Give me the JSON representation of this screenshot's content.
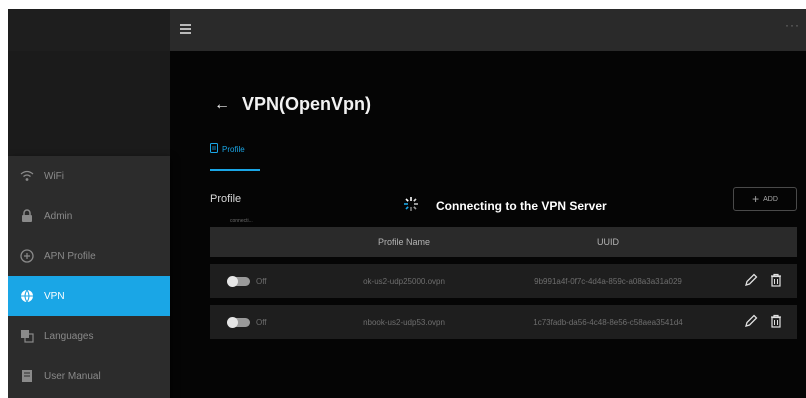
{
  "topbar": {
    "menu_icon": "hamburger-icon",
    "more": "···"
  },
  "sidebar": {
    "items": [
      {
        "label": "WiFi",
        "icon": "wifi-icon"
      },
      {
        "label": "Admin",
        "icon": "lock-icon"
      },
      {
        "label": "APN Profile",
        "icon": "apn-profile-icon"
      },
      {
        "label": "VPN",
        "icon": "vpn-icon",
        "active": true
      },
      {
        "label": "Languages",
        "icon": "language-icon"
      },
      {
        "label": "User Manual",
        "icon": "manual-icon"
      }
    ]
  },
  "page": {
    "back_icon": "←",
    "title": "VPN(OpenVpn)",
    "tab_label": "Profile",
    "section_title": "Profile",
    "connecting_small": "connecti...",
    "add_label": "ADD",
    "add_plus": "+",
    "loading_text": "Connecting to the VPN Server"
  },
  "table": {
    "headers": [
      "Profile Name",
      "UUID"
    ],
    "rows": [
      {
        "state": "Off",
        "profile_name": "ok-us2-udp25000.ovpn",
        "uuid": "9b991a4f-0f7c-4d4a-859c-a08a3a31a029"
      },
      {
        "state": "Off",
        "profile_name": "nbook-us2-udp53.ovpn",
        "uuid": "1c73fadb-da56-4c48-8e56-c58aea3541d4"
      }
    ]
  },
  "colors": {
    "accent": "#1aa6e6",
    "background": "#050505",
    "sidebar": "#1b1b1b",
    "drawer": "#2c2c2c"
  }
}
